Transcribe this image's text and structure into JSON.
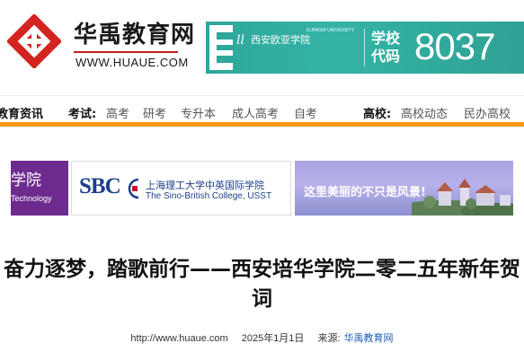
{
  "header": {
    "site_name": "华禹教育网",
    "site_url": "WWW.HUAUE.COM"
  },
  "top_banner": {
    "cursive": "ll",
    "school": "西安欧亚学院",
    "school_en": "EURASIA UNIVERSITY",
    "code_label": "学校代码",
    "code": "8037",
    "colors": {
      "background": "#2fa79a"
    }
  },
  "nav": {
    "items": [
      {
        "label": "教育资讯",
        "strong": true
      },
      {
        "label": "考试:",
        "strong": true
      },
      {
        "label": "高考",
        "strong": false
      },
      {
        "label": "研考",
        "strong": false
      },
      {
        "label": "专升本",
        "strong": false
      },
      {
        "label": "成人高考",
        "strong": false
      },
      {
        "label": "自考",
        "strong": false
      },
      {
        "label": "高校:",
        "strong": true
      },
      {
        "label": "高校动态",
        "strong": false
      },
      {
        "label": "民办高校",
        "strong": false
      }
    ],
    "accent": "#f29611"
  },
  "ads": {
    "ad1": {
      "cn": "学院",
      "en": "Technology"
    },
    "ad2": {
      "logo": "SBC",
      "cn": "上海理工大学中英国际学院",
      "en": "The Sino-British College, USST"
    },
    "ad3": {
      "text": "这里美丽的不只是风景!"
    }
  },
  "article": {
    "title": "奋力逐梦，踏歌前行——西安培华学院二零二五年新年贺词",
    "url": "http://www.huaue.com",
    "date": "2025年1月1日",
    "source_label": "来源:",
    "source": "华禹教育网"
  }
}
